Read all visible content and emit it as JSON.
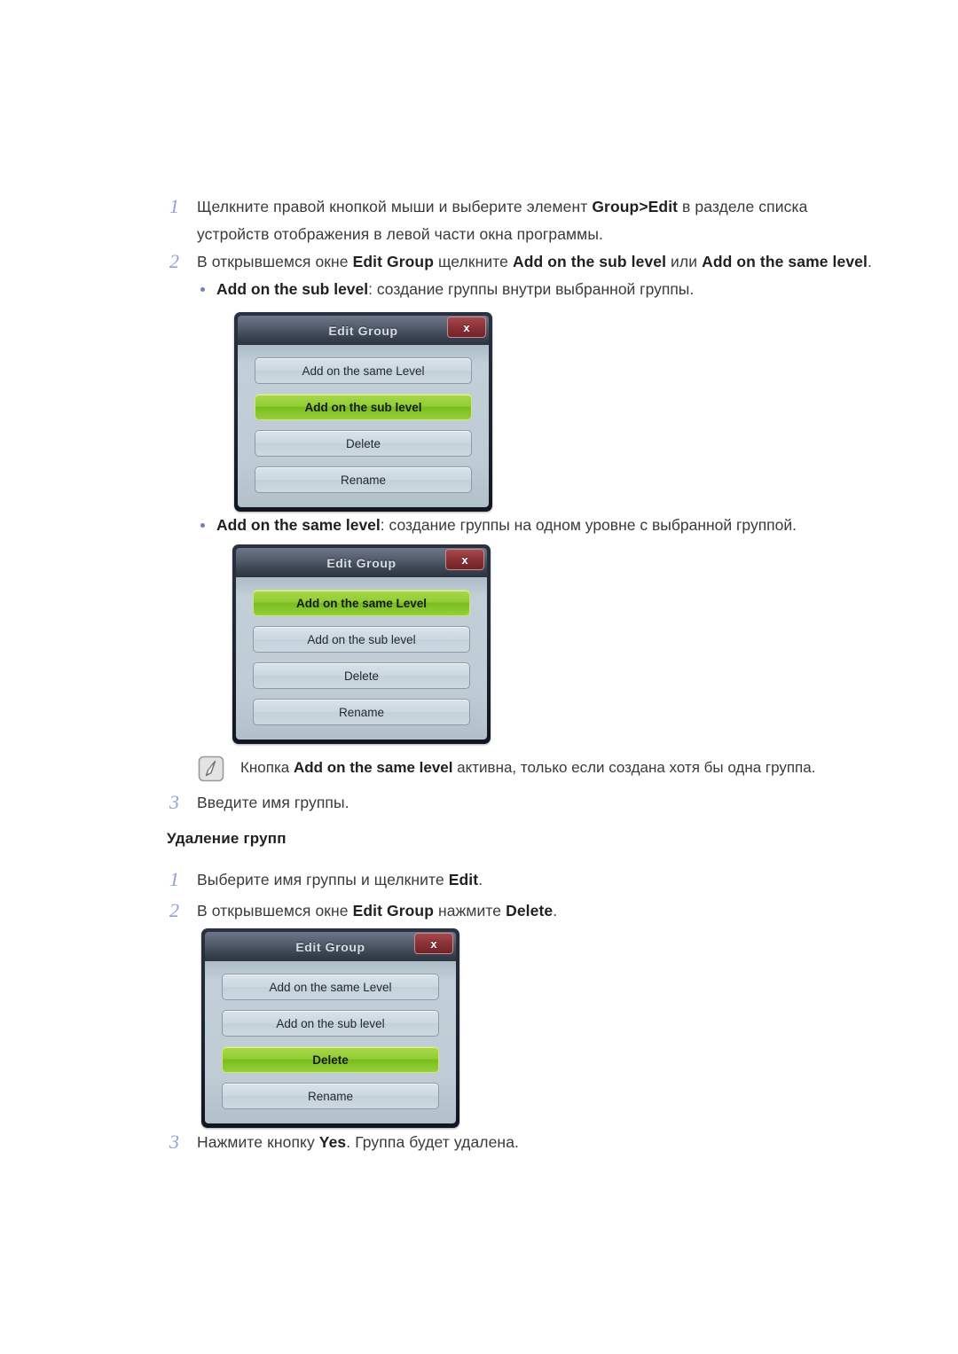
{
  "steps": {
    "s1": {
      "num": "1",
      "line1_a": "Щелкните правой кнопкой мыши и выберите элемент ",
      "line1_b": "Group>Edit",
      "line1_c": " в разделе списка устройств отображения в левой части окна программы."
    },
    "s2": {
      "num": "2",
      "a": "В открывшемся окне ",
      "b": "Edit Group",
      "c": " щелкните ",
      "d": "Add on the sub level",
      "e": " или ",
      "f": "Add on the same level",
      "g": "."
    },
    "s3": {
      "num": "3",
      "text": "Введите имя группы."
    },
    "d1": {
      "num": "1",
      "a": "Выберите имя группы и щелкните ",
      "b": "Edit",
      "c": "."
    },
    "d2": {
      "num": "2",
      "a": "В открывшемся окне ",
      "b": "Edit Group",
      "c": " нажмите ",
      "d": "Delete",
      "e": "."
    },
    "d3": {
      "num": "3",
      "a": "Нажмите кнопку ",
      "b": "Yes",
      "c": ". Группа будет удалена."
    }
  },
  "bullets": {
    "b1": {
      "label": "Add on the sub level",
      "text": ": создание группы внутри выбранной группы."
    },
    "b2": {
      "label": "Add on the same level",
      "text": ": создание группы на одном уровне с выбранной группой."
    }
  },
  "note": {
    "icon": "note-pen-icon",
    "a": "Кнопка ",
    "b": "Add on the same level",
    "c": " активна, только если создана хотя бы одна группа."
  },
  "heading": {
    "delete_groups": "Удаление групп"
  },
  "dialogs": {
    "titlebar": {
      "title": "Edit Group",
      "close_label": "x"
    },
    "buttons": {
      "same_level": "Add on the same Level",
      "sub_level": "Add on the sub level",
      "delete": "Delete",
      "rename": "Rename"
    },
    "dialog1_active": "Add on the sub level",
    "dialog2_active": "Add on the same Level",
    "dialog3_active": "Delete"
  },
  "colors": {
    "step_number": "#8f9fdb",
    "bullet_dot": "#6f7fc4",
    "active_button_green": "#8DC63F",
    "close_button_red": "#8e3338",
    "titlebar_dark": "#39424f",
    "dialog_body": "#bfccd5"
  }
}
